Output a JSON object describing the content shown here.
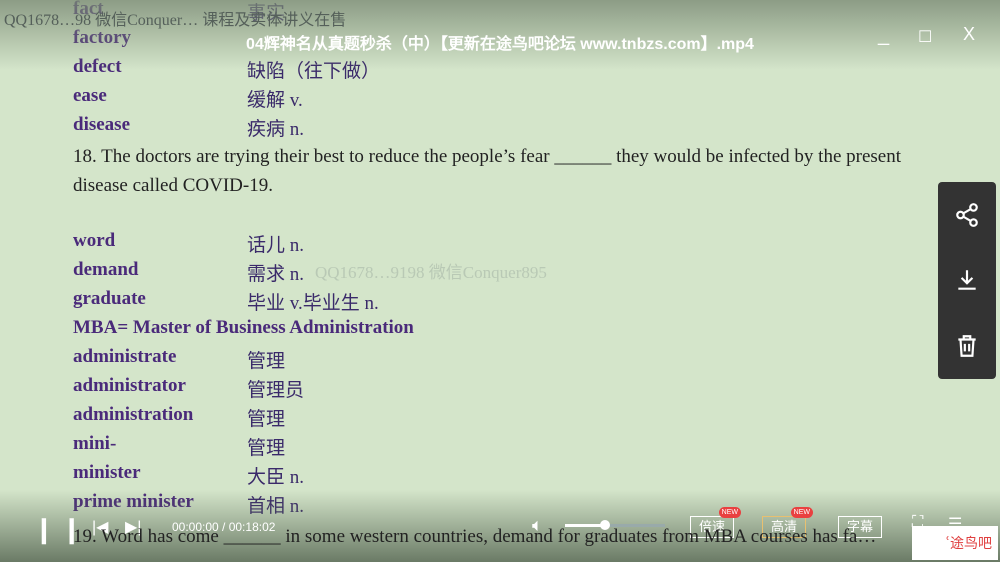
{
  "window": {
    "title": "04辉神名从真题秒杀（中）【更新在途鸟吧论坛 www.tnbzs.com】.mp4",
    "minimize": "_",
    "maximize": "☐",
    "close": "X"
  },
  "doc": {
    "watermark_top": "QQ1678…98  微信Conquer… 课程及实体讲义在售",
    "watermark_mid": "QQ1678…9198  微信Conquer895",
    "vocab1": [
      {
        "en": "fact",
        "cn": "事实"
      },
      {
        "en": "factory",
        "cn": ""
      },
      {
        "en": "defect",
        "cn": "缺陷（往下做）"
      },
      {
        "en": "ease",
        "cn": "缓解 v."
      },
      {
        "en": "disease",
        "cn": "疾病 n."
      }
    ],
    "q18": "18. The doctors are trying their best to reduce the people’s fear ______ they would be infected by the present disease called COVID-19.",
    "vocab2": [
      {
        "en": "word",
        "cn": "话儿 n."
      },
      {
        "en": "demand",
        "cn": "需求 n."
      },
      {
        "en": "graduate",
        "cn": "毕业 v.毕业生 n."
      },
      {
        "en": "MBA= Master of Business Administration",
        "cn": ""
      },
      {
        "en": "administrate",
        "cn": "管理"
      },
      {
        "en": "administrator",
        "cn": "管理员"
      },
      {
        "en": "administration",
        "cn": "管理"
      },
      {
        "en": "mini-",
        "cn": "管理"
      },
      {
        "en": "minister",
        "cn": "大臣 n."
      },
      {
        "en": "prime minister",
        "cn": "首相 n."
      }
    ],
    "q19": "19. Word has come ______ in some western countries, demand for graduates from MBA courses has fa…"
  },
  "player": {
    "time": "00:00:00 / 00:18:02",
    "volume_percent": 40,
    "progress_percent": 0,
    "speed": "倍速",
    "quality": "高清",
    "subtitle": "字幕",
    "new_badge": "NEW",
    "logo": "途鸟吧",
    "side_icons": [
      "share-icon",
      "download-icon",
      "trash-icon"
    ]
  }
}
